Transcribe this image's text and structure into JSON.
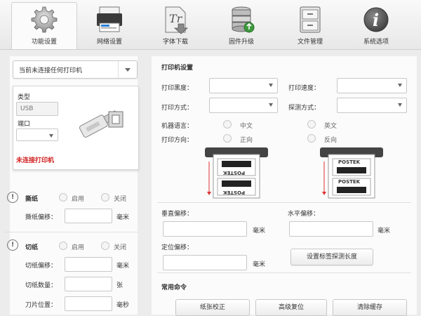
{
  "toolbar": {
    "items": [
      {
        "label": "功能设置",
        "icon": "gear-icon",
        "active": true
      },
      {
        "label": "网络设置",
        "icon": "network-printer-icon"
      },
      {
        "label": "字体下载",
        "icon": "font-download-icon"
      },
      {
        "label": "固件升级",
        "icon": "firmware-database-icon"
      },
      {
        "label": "文件管理",
        "icon": "file-cabinet-icon"
      },
      {
        "label": "系统选项",
        "icon": "info-icon"
      }
    ]
  },
  "left": {
    "printer_select": "当前未连接任何打印机",
    "type_label": "类型",
    "type_value": "USB",
    "port_label": "端口",
    "status_warning": "未连接打印机",
    "tear": {
      "title": "撕纸",
      "enable": "启用",
      "disable": "关闭",
      "offset_label": "撕纸偏移：",
      "offset_unit": "毫米"
    },
    "cut": {
      "title": "切纸",
      "enable": "启用",
      "disable": "关闭",
      "offset_label": "切纸偏移：",
      "offset_unit": "毫米",
      "count_label": "切纸数量：",
      "count_unit": "张",
      "blade_label": "刀片位置：",
      "blade_unit": "毫秒"
    }
  },
  "right": {
    "section_title": "打印机设置",
    "darkness_label": "打印黑度：",
    "speed_label": "打印速度：",
    "method_label": "打印方式：",
    "detect_label": "探测方式：",
    "language_label": "机器语言：",
    "lang_cn": "中文",
    "lang_en": "英文",
    "direction_label": "打印方向：",
    "dir_forward": "正向",
    "dir_reverse": "反向",
    "label_brand": "POSTEK",
    "vertical_offset_label": "垂直偏移：",
    "horizontal_offset_label": "水平偏移：",
    "mm_unit": "毫米",
    "position_offset_label": "定位偏移：",
    "set_label_length_button": "设置标签探测长度",
    "commands_title": "常用命令",
    "commands": [
      "纸张校正",
      "高级复位",
      "清除缓存"
    ]
  },
  "colors": {
    "warning": "#d21f1f",
    "background": "#ececec",
    "panel": "#fbfbfb"
  }
}
